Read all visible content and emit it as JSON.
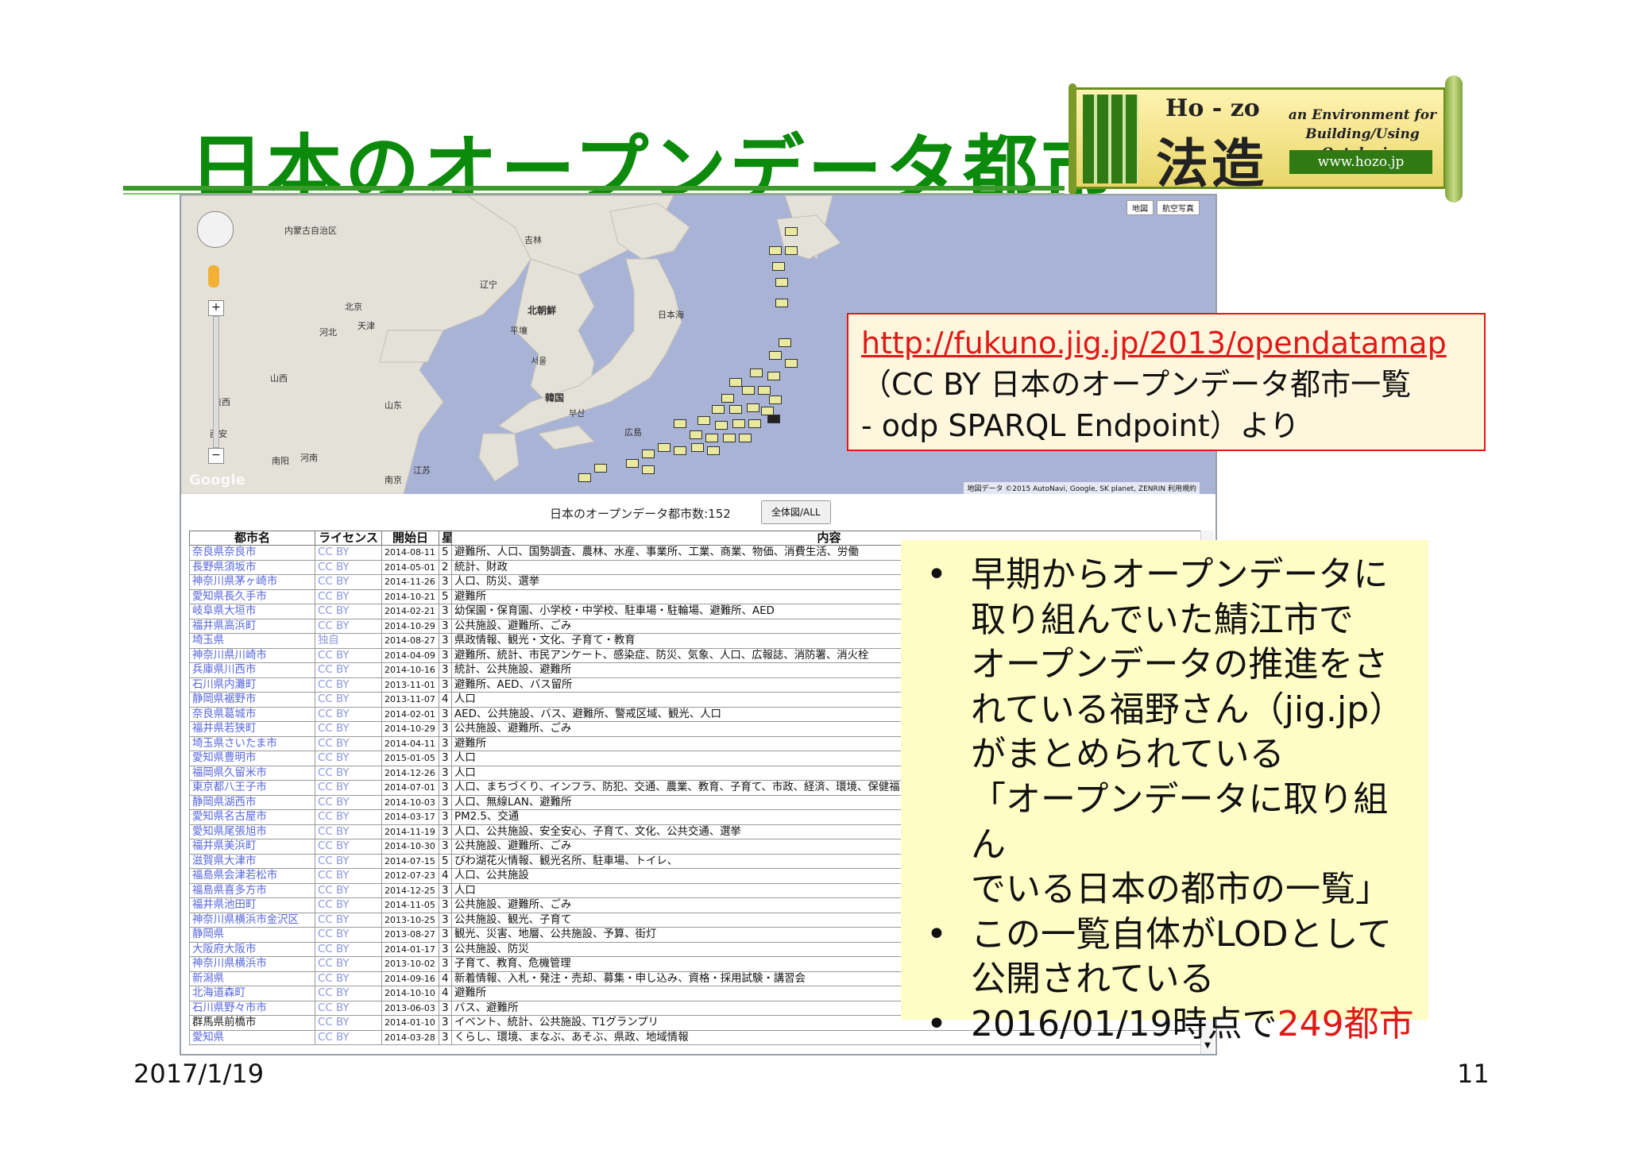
{
  "slide": {
    "title": "日本のオープンデータ都市",
    "date": "2017/1/19",
    "page": "11"
  },
  "logo": {
    "name": "Ho - zo",
    "kanji": "法造",
    "tagline": "an Environment for Building/Using Ontologies",
    "url": "www.hozo.jp"
  },
  "map": {
    "type_buttons": [
      "地図",
      "航空写真"
    ],
    "labels": [
      "内蒙古自治区",
      "吉林",
      "辽宁",
      "北京",
      "天津",
      "河北",
      "北朝鮮",
      "平壤",
      "日本海",
      "서울",
      "韓国",
      "부산",
      "山西",
      "陕西",
      "山东",
      "西安",
      "南阳",
      "河南",
      "南京",
      "江苏",
      "広島"
    ],
    "attribution": "地図データ ©2015 AutoNavi, Google, SK planet, ZENRIN  利用規約",
    "google_mark": "Google"
  },
  "count_bar": {
    "text": "日本のオープンデータ都市数:152",
    "button": "全体図/ALL"
  },
  "table": {
    "headers": [
      "都市名",
      "ライセンス",
      "開始日",
      "星",
      "内容"
    ],
    "rows": [
      [
        "奈良県奈良市",
        "CC BY",
        "2014-08-11",
        "5",
        "避難所、人口、国勢調査、農林、水産、事業所、工業、商業、物価、消費生活、労働"
      ],
      [
        "長野県須坂市",
        "CC BY",
        "2014-05-01",
        "2",
        "統計、財政"
      ],
      [
        "神奈川県茅ヶ崎市",
        "CC BY",
        "2014-11-26",
        "3",
        "人口、防災、選挙"
      ],
      [
        "愛知県長久手市",
        "CC BY",
        "2014-10-21",
        "5",
        "避難所"
      ],
      [
        "岐阜県大垣市",
        "CC BY",
        "2014-02-21",
        "3",
        "幼保園・保育園、小学校・中学校、駐車場・駐輪場、避難所、AED"
      ],
      [
        "福井県高浜町",
        "CC BY",
        "2014-10-29",
        "3",
        "公共施設、避難所、ごみ"
      ],
      [
        "埼玉県",
        "独自",
        "2014-08-27",
        "3",
        "県政情報、観光・文化、子育て・教育"
      ],
      [
        "神奈川県川崎市",
        "CC BY",
        "2014-04-09",
        "3",
        "避難所、統計、市民アンケート、感染症、防災、気象、人口、広報誌、消防署、消火栓"
      ],
      [
        "兵庫県川西市",
        "CC BY",
        "2014-10-16",
        "3",
        "統計、公共施設、避難所"
      ],
      [
        "石川県内灘町",
        "CC BY",
        "2013-11-01",
        "3",
        "避難所、AED、バス留所"
      ],
      [
        "静岡県裾野市",
        "CC BY",
        "2013-11-07",
        "4",
        "人口"
      ],
      [
        "奈良県葛城市",
        "CC BY",
        "2014-02-01",
        "3",
        "AED、公共施設、バス、避難所、警戒区域、観光、人口"
      ],
      [
        "福井県若狭町",
        "CC BY",
        "2014-10-29",
        "3",
        "公共施設、避難所、ごみ"
      ],
      [
        "埼玉県さいたま市",
        "CC BY",
        "2014-04-11",
        "3",
        "避難所"
      ],
      [
        "愛知県豊明市",
        "CC BY",
        "2015-01-05",
        "3",
        "人口"
      ],
      [
        "福岡県久留米市",
        "CC BY",
        "2014-12-26",
        "3",
        "人口"
      ],
      [
        "東京都八王子市",
        "CC BY",
        "2014-07-01",
        "3",
        "人口、まちづくり、インフラ、防犯、交通、農業、教育、子育て、市政、経済、環境、保健福"
      ],
      [
        "静岡県湖西市",
        "CC BY",
        "2014-10-03",
        "3",
        "人口、無線LAN、避難所"
      ],
      [
        "愛知県名古屋市",
        "CC BY",
        "2014-03-17",
        "3",
        "PM2.5、交通"
      ],
      [
        "愛知県尾張旭市",
        "CC BY",
        "2014-11-19",
        "3",
        "人口、公共施設、安全安心、子育て、文化、公共交通、選挙"
      ],
      [
        "福井県美浜町",
        "CC BY",
        "2014-10-30",
        "3",
        "公共施設、避難所、ごみ"
      ],
      [
        "滋賀県大津市",
        "CC BY",
        "2014-07-15",
        "5",
        "びわ湖花火情報、観光名所、駐車場、トイレ、"
      ],
      [
        "福島県会津若松市",
        "CC BY",
        "2012-07-23",
        "4",
        "人口、公共施設"
      ],
      [
        "福島県喜多方市",
        "CC BY",
        "2014-12-25",
        "3",
        "人口"
      ],
      [
        "福井県池田町",
        "CC BY",
        "2014-11-05",
        "3",
        "公共施設、避難所、ごみ"
      ],
      [
        "神奈川県横浜市金沢区",
        "CC BY",
        "2013-10-25",
        "3",
        "公共施設、観光、子育て"
      ],
      [
        "静岡県",
        "CC BY",
        "2013-08-27",
        "3",
        "観光、災害、地層、公共施設、予算、街灯"
      ],
      [
        "大阪府大阪市",
        "CC BY",
        "2014-01-17",
        "3",
        "公共施設、防災"
      ],
      [
        "神奈川県横浜市",
        "CC BY",
        "2013-10-02",
        "3",
        "子育て、教育、危機管理"
      ],
      [
        "新潟県",
        "CC BY",
        "2014-09-16",
        "4",
        "新着情報、入札・発注・売却、募集・申し込み、資格・採用試験・講習会"
      ],
      [
        "北海道森町",
        "CC BY",
        "2014-10-10",
        "4",
        "避難所"
      ],
      [
        "石川県野々市市",
        "CC BY",
        "2013-06-03",
        "3",
        "バス、避難所"
      ],
      [
        "群馬県前橋市",
        "CC BY",
        "2014-01-10",
        "3",
        "イベント、統計、公共施設、T1グランプリ"
      ],
      [
        "愛知県",
        "CC BY",
        "2014-03-28",
        "3",
        "くらし、環境、まなぶ、あそぶ、県政、地域情報"
      ]
    ]
  },
  "source_box": {
    "url": "http://fukuno.jig.jp/2013/opendatamap",
    "line2": "（CC BY 日本のオープンデータ都市一覧",
    "line3": "  - odp SPARQL Endpoint）より"
  },
  "bullets": {
    "b1": [
      "早期からオープンデータに",
      "取り組んでいた鯖江市で",
      "オープンデータの推進をさ",
      "れている福野さん（jig.jp）",
      "がまとめられている",
      "「オープンデータに取り組ん",
      "でいる日本の都市の一覧」"
    ],
    "b2": [
      "この一覧自体がLODとして",
      "公開されている"
    ],
    "b3_prefix": "2016/01/19時点で",
    "b3_highlight": "249都市",
    "dot": "•"
  },
  "colors": {
    "title_green": "#0c8a0c",
    "accent_red": "#e01818",
    "map_sea": "#a8b3d6",
    "map_land": "#e4e1d8",
    "bullet_bg": "#fffdc6",
    "source_bg": "#fff7dd",
    "link_blue": "#5566dd"
  },
  "icons": [
    "pan-control-icon",
    "pegman-icon",
    "zoom-in-icon",
    "zoom-out-icon",
    "scroll-down-icon"
  ]
}
